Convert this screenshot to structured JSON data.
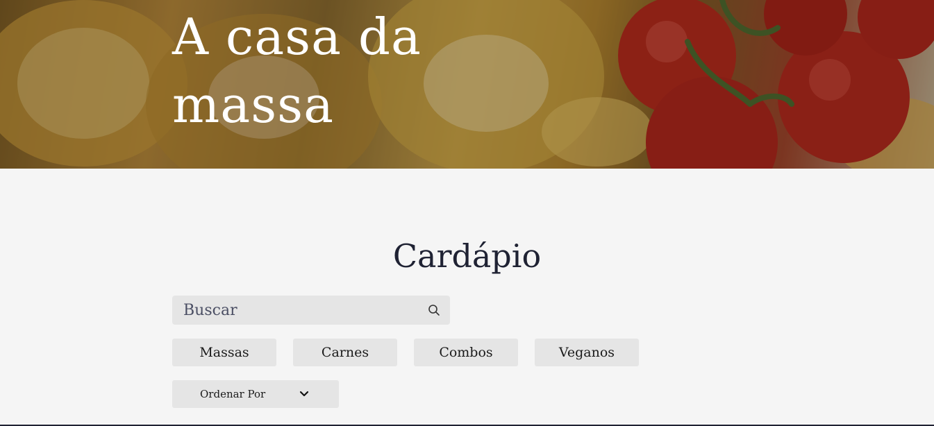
{
  "hero": {
    "title": "A casa da massa",
    "image": "pasta-and-tomatoes-photo"
  },
  "menu": {
    "title": "Cardápio",
    "search": {
      "placeholder": "Buscar",
      "value": "",
      "icon": "search-icon"
    },
    "filters": [
      {
        "label": "Massas"
      },
      {
        "label": "Carnes"
      },
      {
        "label": "Combos"
      },
      {
        "label": "Veganos"
      }
    ],
    "sort": {
      "label": "Ordenar Por",
      "icon": "chevron-down-icon"
    }
  },
  "colors": {
    "background": "#f5f5f5",
    "control": "#e5e5e5",
    "title_text": "#1f2233",
    "hero_text": "#ffffff"
  }
}
